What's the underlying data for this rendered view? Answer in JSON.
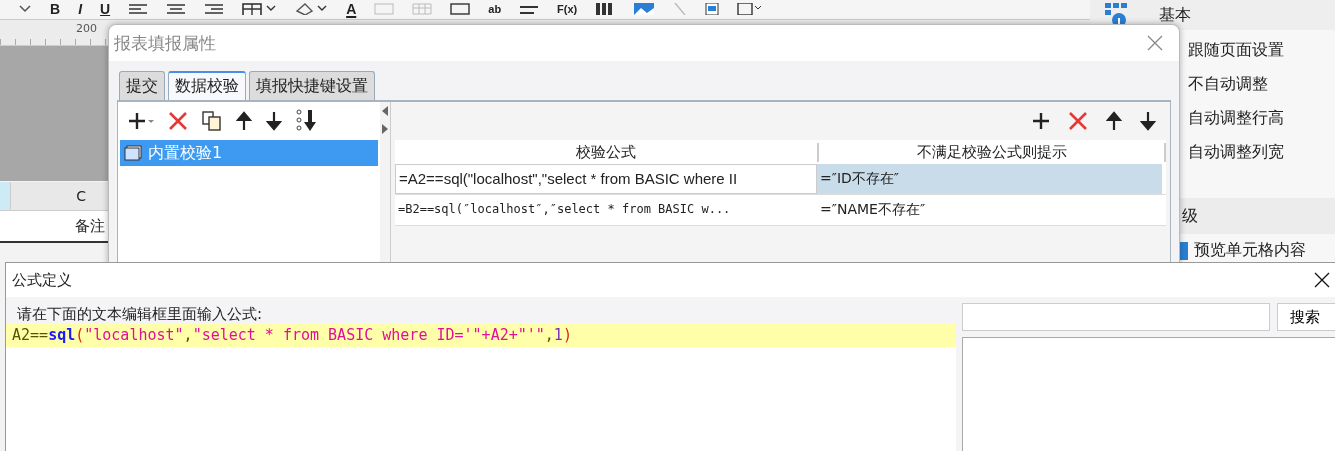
{
  "toolbar": {
    "buttons": [
      "B",
      "I",
      "U",
      "A",
      "ab",
      "F(x)"
    ]
  },
  "ruler": {
    "mark": "200"
  },
  "sheet": {
    "column_header": "C",
    "cell": "备注"
  },
  "property_panel": {
    "section_1": "基本",
    "options": [
      {
        "label": "跟随页面设置"
      },
      {
        "label": "不自动调整"
      },
      {
        "label": "自动调整行高"
      },
      {
        "label": "自动调整列宽"
      }
    ],
    "section_2": "级",
    "checkbox": {
      "label": "预览单元格内容",
      "checked": true
    }
  },
  "fill_dialog": {
    "title": "报表填报属性",
    "tabs": [
      {
        "label": "提交",
        "selected": false
      },
      {
        "label": "数据校验",
        "selected": true
      },
      {
        "label": "填报快捷键设置",
        "selected": false
      }
    ],
    "list": [
      {
        "label": "内置校验1",
        "selected": true
      }
    ],
    "table": {
      "columns": [
        "校验公式",
        "不满足校验公式则提示"
      ],
      "rows": [
        {
          "formula": "=A2==sql(\"localhost\",\"select * from BASIC where II",
          "message": "=″ID不存在″",
          "selected": true
        },
        {
          "formula": "=B2==sql(″localhost″,″select * from BASIC w...",
          "message": "=″NAME不存在″",
          "selected": false
        }
      ]
    }
  },
  "formula_dialog": {
    "title": "公式定义",
    "prompt": "请在下面的文本编辑框里面输入公式:",
    "code": [
      {
        "kind": "plain",
        "text": "A2=="
      },
      {
        "kind": "func",
        "text": "sql"
      },
      {
        "kind": "paren",
        "text": "("
      },
      {
        "kind": "string",
        "text": "\"localhost\""
      },
      {
        "kind": "plain",
        "text": ","
      },
      {
        "kind": "string",
        "text": "\"select * from BASIC where ID='\"+A2+\"'\""
      },
      {
        "kind": "plain",
        "text": ","
      },
      {
        "kind": "number",
        "text": "1"
      },
      {
        "kind": "paren",
        "text": ")"
      }
    ],
    "search_button": "搜索"
  }
}
